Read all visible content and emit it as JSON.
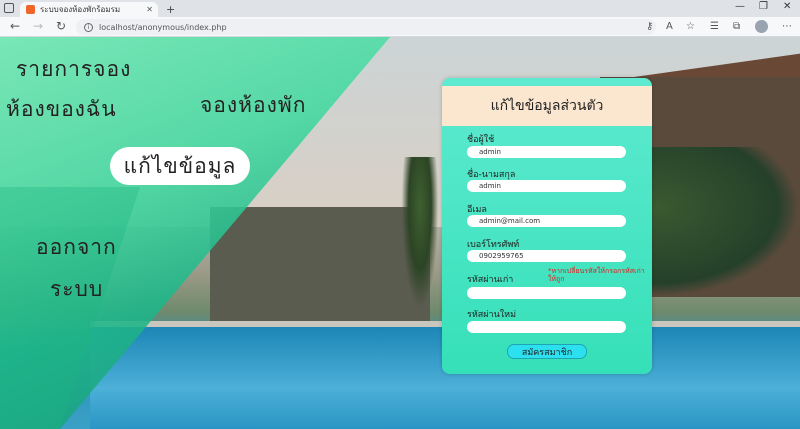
{
  "browser": {
    "tab_title": "ระบบจองห้องพักร้อมรม",
    "url": "localhost/anonymous/index.php"
  },
  "menu": {
    "my_bookings_line1": "รายการจอง",
    "my_bookings_line2": "ห้องของฉัน",
    "book_room": "จองห้องพัก",
    "edit_profile": "แก้ไขข้อมูล",
    "logout_line1": "ออกจาก",
    "logout_line2": "ระบบ"
  },
  "form": {
    "title": "แก้ไขข้อมูลส่วนตัว",
    "username_label": "ชื่อผู้ใช้",
    "username_value": "admin",
    "fullname_label": "ชื่อ-นามสกุล",
    "fullname_value": "admin",
    "email_label": "อีเมล",
    "email_value": "admin@mail.com",
    "phone_label": "เบอร์โทรศัพท์",
    "phone_value": "0902959765",
    "old_password_label": "รหัสผ่านเก่า",
    "old_password_value": "",
    "warning": "*หากเปลี่ยนรหัสให้กรอกรหัสเก่าให้ถูก",
    "new_password_label": "รหัสผ่านใหม่",
    "new_password_value": "",
    "submit_label": "สมัครสมาชิก"
  },
  "colors": {
    "accent_green": "#35e0b8",
    "title_bg": "#fbe6cf",
    "submit_bg": "#2de0f0",
    "warning": "#e02020"
  }
}
